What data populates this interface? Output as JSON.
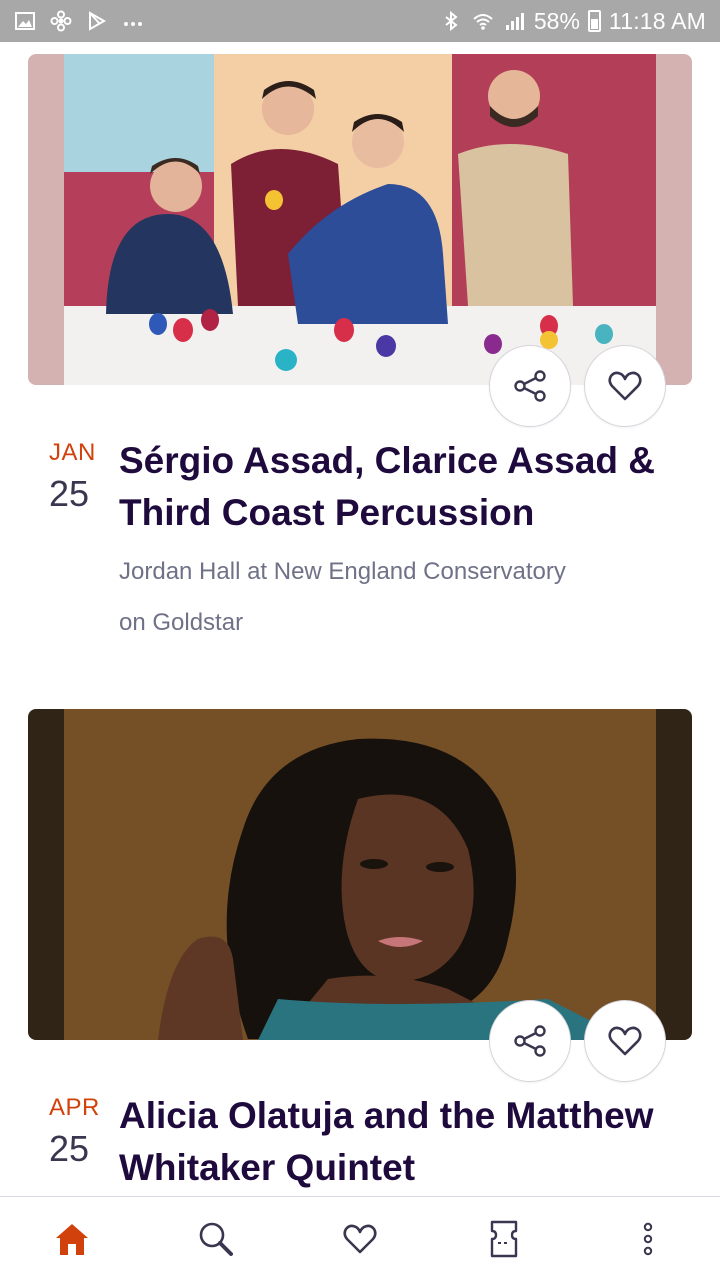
{
  "status_bar": {
    "battery": "58%",
    "time": "11:18 AM",
    "left_icons": [
      "image-notification-icon",
      "fan-icon",
      "play-store-icon",
      "more-notifications-icon"
    ],
    "right_icons": [
      "bluetooth-icon",
      "wifi-icon",
      "signal-icon",
      "battery-icon"
    ]
  },
  "events": [
    {
      "month": "JAN",
      "day": "25",
      "title": "Sérgio Assad, Clarice Assad & Third Coast Percussion",
      "venue": "Jordan Hall at New England Conservatory",
      "source": "on Goldstar"
    },
    {
      "month": "APR",
      "day": "25",
      "title": "Alicia Olatuja and the Matthew Whitaker Quintet",
      "venue": "",
      "source": ""
    }
  ],
  "bottom_nav": [
    {
      "icon": "home-icon",
      "active": true
    },
    {
      "icon": "search-icon",
      "active": false
    },
    {
      "icon": "heart-icon",
      "active": false
    },
    {
      "icon": "ticket-icon",
      "active": false
    },
    {
      "icon": "more-vertical-icon",
      "active": false
    }
  ],
  "colors": {
    "accent": "#d1410c",
    "title": "#1e0a3c",
    "secondary_text": "#6f7287",
    "status_bar": "#a8a8a8"
  }
}
